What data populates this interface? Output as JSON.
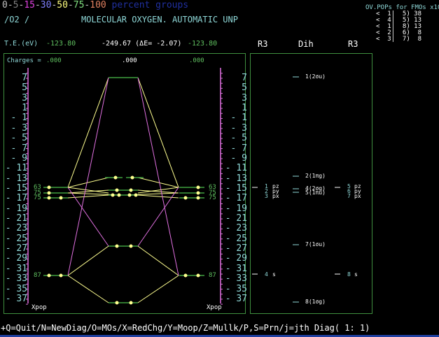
{
  "legend": {
    "items": [
      {
        "text": "0",
        "color": "#c0c0c0"
      },
      {
        "text": "-",
        "color": "#c0c0c0"
      },
      {
        "text": "5",
        "color": "#808080"
      },
      {
        "text": "-",
        "color": "#c0c0c0"
      },
      {
        "text": "15",
        "color": "#e040e0"
      },
      {
        "text": "-",
        "color": "#c0c0c0"
      },
      {
        "text": "30",
        "color": "#8080ff"
      },
      {
        "text": "-",
        "color": "#c0c0c0"
      },
      {
        "text": "50",
        "color": "#ffff80"
      },
      {
        "text": "-",
        "color": "#c0c0c0"
      },
      {
        "text": "75",
        "color": "#80e080"
      },
      {
        "text": "-",
        "color": "#c0c0c0"
      },
      {
        "text": "100",
        "color": "#e08060"
      }
    ],
    "suffix": " percent groups"
  },
  "molecule": "/O2 /",
  "title": "MOLECULAR OXYGEN. AUTOMATIC UNP",
  "energy": {
    "label": "T.E.(eV)",
    "left": "-123.80",
    "center": "-249.67 (ΔE= -2.07)",
    "right": "-123.80"
  },
  "charges": {
    "label": "Charges =",
    "left": ".000",
    "center": ".000",
    "right": ".000"
  },
  "ovpop": {
    "title": "OV.POPs for FMOs x100",
    "rows": [
      "<  1|  5) 38",
      "<  4|  5) 13",
      "<  1|  8) 13",
      "<  2|  6)  8",
      "<  3|  7)  8"
    ]
  },
  "columns": [
    "R3",
    "Dih",
    "R3"
  ],
  "axis_ticks": [
    "7",
    "5",
    "3",
    "1",
    "- 1",
    "- 3",
    "- 5",
    "- 7",
    "- 9",
    "- 11",
    "- 13",
    "- 15",
    "- 17",
    "- 19",
    "- 21",
    "- 23",
    "- 25",
    "- 27",
    "- 29",
    "- 31",
    "- 33",
    "- 35",
    "- 37"
  ],
  "xpop_label": "Xpop",
  "left_pops": [
    "63",
    "75",
    "75",
    "87"
  ],
  "right_pops": [
    "63",
    "75",
    "75",
    "87"
  ],
  "left_orbitals": [
    {
      "num": "1",
      "type": "pz"
    },
    {
      "num": "2",
      "type": "py"
    },
    {
      "num": "3",
      "type": "px"
    },
    {
      "num": "4",
      "type": "s"
    }
  ],
  "right_orbitals": [
    {
      "num": "5",
      "type": "pz"
    },
    {
      "num": "6",
      "type": "py"
    },
    {
      "num": "7",
      "type": "px"
    },
    {
      "num": "8",
      "type": "s"
    }
  ],
  "mo_labels": [
    "1(2σu)",
    "2(1πg)",
    "4(2σg)",
    "5(1πu)",
    "7(1σu)",
    "8(1σg)"
  ],
  "command_bar": "+Q=Quit/N=NewDiag/O=MOs/X=RedChg/Y=Moop/Z=Mullk/P,S=Prn/j=jth Diag( 1: 1)"
}
